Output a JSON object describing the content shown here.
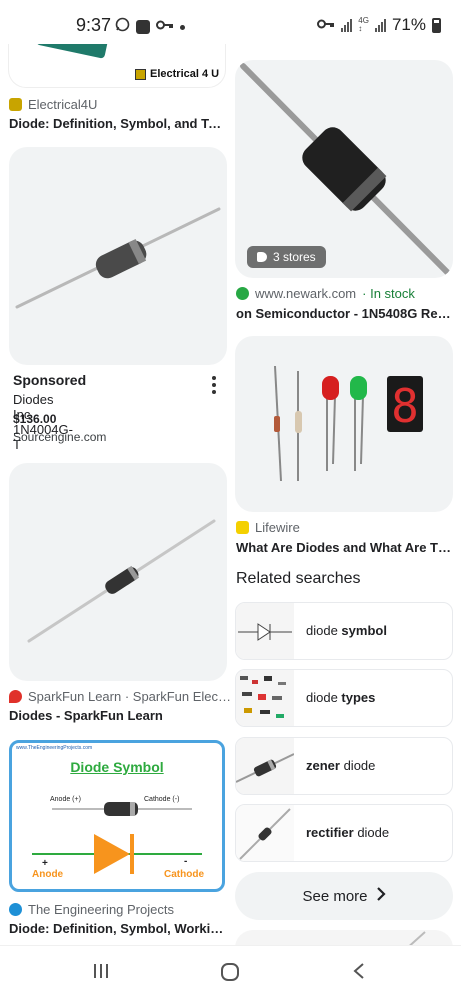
{
  "status": {
    "time": "9:37",
    "battery": "71%",
    "icons_left": [
      "whatsapp-icon",
      "gallery-icon",
      "key-icon",
      "dot-icon"
    ],
    "icons_right": [
      "key-icon",
      "signal-icon",
      "data-icon",
      "signal-icon",
      "battery-icon"
    ]
  },
  "left_column": {
    "card1": {
      "source": "Electrical4U",
      "title": "Diode: Definition, Symbol, and Typ…",
      "image_text": "Electrical 4 U"
    },
    "card2": {
      "sponsored": "Sponsored",
      "name": "Diodes Inc 1N4004G-T",
      "price": "$136.00",
      "seller": "Sourcengine.com"
    },
    "card3": {
      "source": "SparkFun Learn · SparkFun Elec…",
      "title": "Diodes - SparkFun Learn"
    },
    "card4": {
      "source": "The Engineering Projects",
      "title": "Diode: Definition, Symbol, Working…",
      "image_title": "Diode Symbol",
      "image_site": "www.TheEngineeringProjects.com",
      "anode_lead": "Anode (+)",
      "cathode_lead": "Cathode (-)",
      "anode": "Anode",
      "cathode": "Cathode",
      "plus": "+",
      "minus": "-"
    }
  },
  "right_column": {
    "card1": {
      "stores": "3 stores",
      "source": "www.newark.com",
      "stock": "· In stock",
      "title": "on Semiconductor - 1N5408G Rect…"
    },
    "card2": {
      "source": "Lifewire",
      "title": "What Are Diodes and What Are Th…"
    }
  },
  "related": {
    "heading": "Related searches",
    "items": [
      {
        "plain": "diode ",
        "bold": "symbol",
        "suffix": ""
      },
      {
        "plain": "diode ",
        "bold": "types",
        "suffix": ""
      },
      {
        "plain": "",
        "bold": "zener",
        "suffix": " diode"
      },
      {
        "plain": "",
        "bold": "rectifier",
        "suffix": " diode"
      }
    ],
    "see_more": "See more"
  },
  "colors": {
    "accent_orange": "#f7941d",
    "stock_green": "#188038",
    "tep_green": "#2eaa3f"
  }
}
